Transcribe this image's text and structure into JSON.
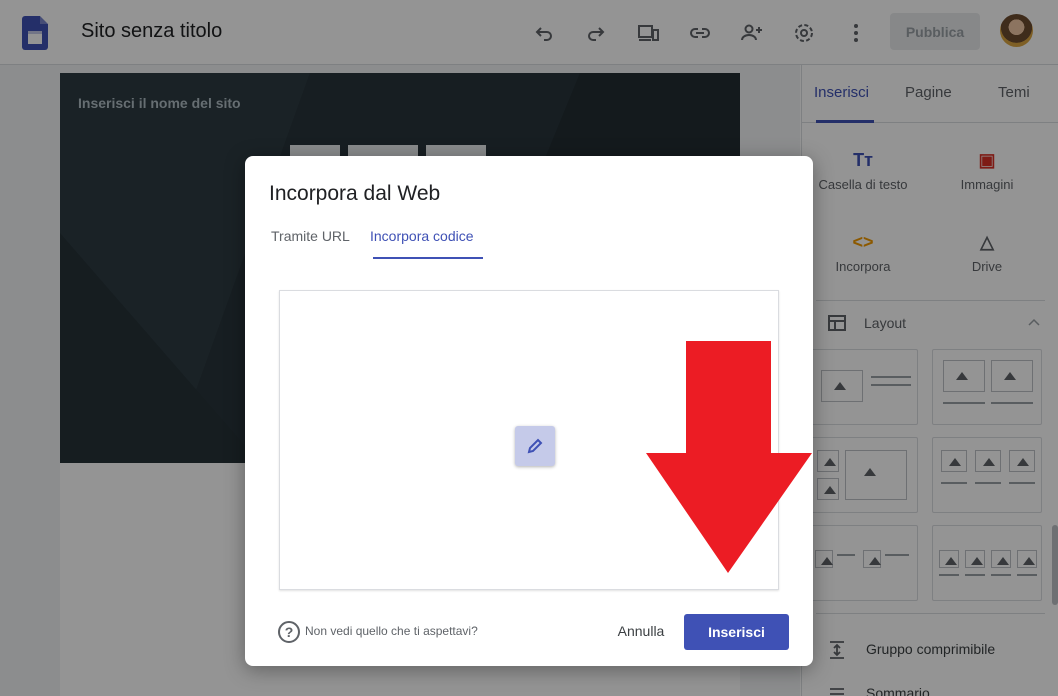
{
  "app": {
    "title": "Sito senza titolo",
    "publish_label": "Pubblica"
  },
  "toolbar": {
    "icons": [
      "undo-icon",
      "redo-icon",
      "preview-icon",
      "link-icon",
      "share-icon",
      "settings-icon",
      "more-icon"
    ]
  },
  "canvas": {
    "site_name_placeholder": "Inserisci il nome del sito"
  },
  "side_panel": {
    "tabs": [
      "Inserisci",
      "Pagine",
      "Temi"
    ],
    "active_tab": "Inserisci",
    "insert_items": [
      {
        "label": "Casella di testo",
        "icon": "text-box-icon",
        "symbol": "Tт",
        "color": "#3f51b5"
      },
      {
        "label": "Immagini",
        "icon": "image-icon",
        "symbol": "▣",
        "color": "#d93025"
      },
      {
        "label": "Incorpora",
        "icon": "embed-icon",
        "symbol": "<>",
        "color": "#f29900"
      },
      {
        "label": "Drive",
        "icon": "drive-icon",
        "symbol": "△",
        "color": "#5f6368"
      }
    ],
    "layout_label": "Layout",
    "collapsible_group_label": "Gruppo comprimibile",
    "table_of_contents_label": "Sommario"
  },
  "dialog": {
    "title": "Incorpora dal Web",
    "tabs": [
      "Tramite URL",
      "Incorpora codice"
    ],
    "active_tab": "Incorpora codice",
    "help_text": "Non vedi quello che ti aspettavi?",
    "cancel_label": "Annulla",
    "insert_label": "Inserisci"
  },
  "annotation": {
    "arrow_color": "#ec1c24",
    "arrow_direction": "down"
  },
  "colors": {
    "accent": "#3f51b5",
    "hero_background": "#263238"
  }
}
